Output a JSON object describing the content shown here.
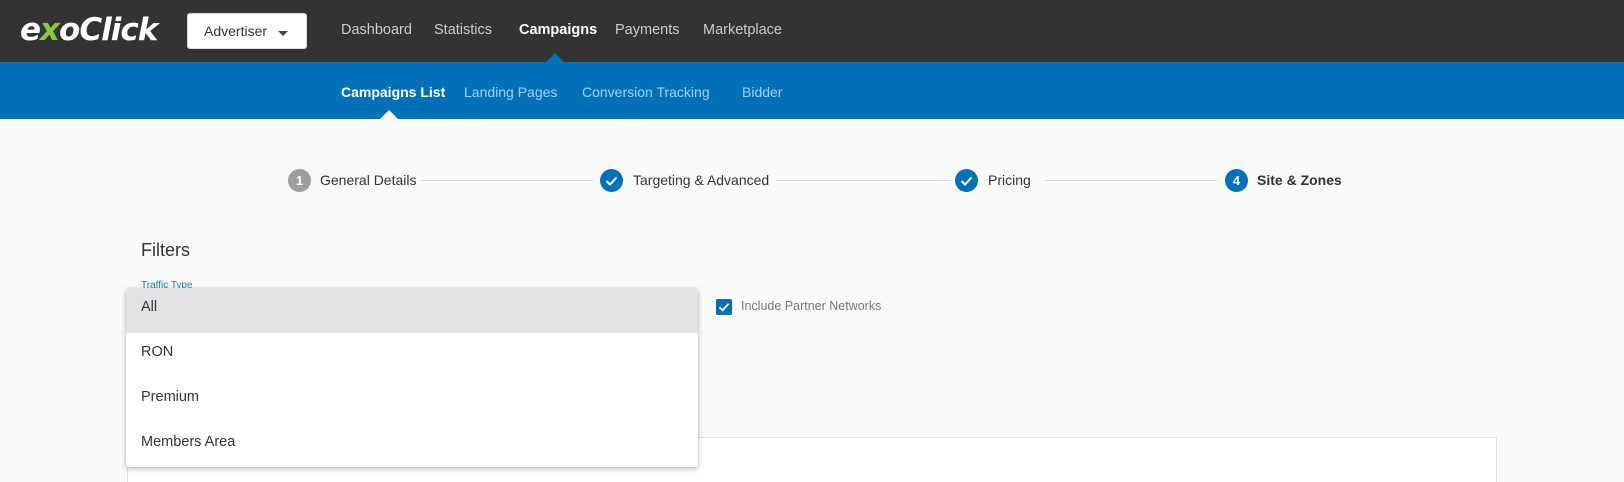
{
  "header": {
    "logo": {
      "pre": "e",
      "x": "x",
      "post": "oClick"
    },
    "account_button": "Advertiser",
    "main_nav": [
      "Dashboard",
      "Statistics",
      "Campaigns",
      "Payments",
      "Marketplace"
    ],
    "active_main": "Campaigns"
  },
  "subnav": {
    "items": [
      "Campaigns List",
      "Landing Pages",
      "Conversion Tracking",
      "Bidder"
    ],
    "active": "Campaigns List"
  },
  "stepper": {
    "steps": [
      {
        "number": "1",
        "label": "General Details",
        "state": "pending"
      },
      {
        "number": "",
        "label": "Targeting & Advanced",
        "state": "done"
      },
      {
        "number": "",
        "label": "Pricing",
        "state": "done"
      },
      {
        "number": "4",
        "label": "Site & Zones",
        "state": "current"
      }
    ]
  },
  "filters": {
    "title": "Filters",
    "traffic_type_label": "Traffic Type",
    "include_partner_networks": {
      "label": "Include Partner Networks",
      "checked": true
    },
    "traffic_type_options": [
      "All",
      "RON",
      "Premium",
      "Members Area"
    ],
    "selected_option": "All"
  },
  "colors": {
    "topbar": "#333333",
    "brand_blue": "#0070b9",
    "logo_accent": "#8cc63f",
    "step_pending": "#9e9e9e"
  }
}
